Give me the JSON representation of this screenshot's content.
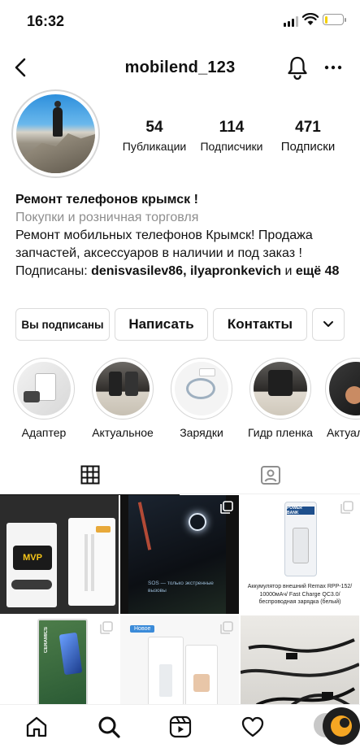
{
  "status_bar": {
    "time": "16:32",
    "battery_level": 0.15,
    "battery_color": "#f5d000"
  },
  "header": {
    "username": "mobilend_123"
  },
  "profile": {
    "stats": [
      {
        "value": "54",
        "label": "Публикации"
      },
      {
        "value": "114",
        "label": "Подписчики"
      },
      {
        "value": "471",
        "label": "Подписки"
      }
    ],
    "name": "Ремонт телефонов крымск !",
    "category": "Покупки и розничная торговля",
    "bio": "Ремонт мобильных телефонов Крымск! Продажа запчастей, аксессуаров в наличии и под заказ !",
    "followed_by": {
      "prefix": "Подписаны: ",
      "users": "denisvasilev86, ilyapronkevich",
      "middle": " и ",
      "suffix": "ещё 48"
    }
  },
  "actions": {
    "following_label": "Вы подписаны",
    "message_label": "Написать",
    "contacts_label": "Контакты"
  },
  "highlights": [
    {
      "label": "Адаптер"
    },
    {
      "label": "Актуальное"
    },
    {
      "label": "Зарядки"
    },
    {
      "label": "Гидр пленка"
    },
    {
      "label": "Актуаль"
    }
  ],
  "tabs": {
    "grid_icon": "grid-icon",
    "tagged_icon": "tagged-icon"
  },
  "posts": [
    {
      "caption": "",
      "brand": "MVP"
    },
    {
      "caption": "",
      "screen_text": "SOS — только экстренные вызовы"
    },
    {
      "caption": "Аккумулятор внешний Remax RPP-152/ 10000мАч/ Fast Charge QC3.0/ беспроводная зарядка (белый)",
      "brand": "POWER BANK"
    },
    {
      "caption": "",
      "brand": "CERAMICS"
    },
    {
      "caption": "",
      "badge": "Новое"
    },
    {
      "caption": ""
    }
  ],
  "bottom_nav": [
    "home-icon",
    "search-icon",
    "reels-icon",
    "heart-icon",
    "profile-icon"
  ],
  "colors": {
    "text": "#111111",
    "secondary": "#8e8e8e",
    "border": "#dbdbdb",
    "accent_orange": "#f5a623"
  }
}
